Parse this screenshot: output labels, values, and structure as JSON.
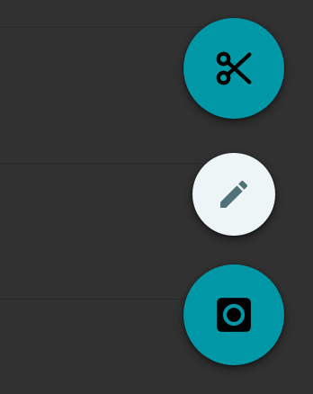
{
  "actions": [
    {
      "name": "cut",
      "icon": "scissors-icon",
      "background": "#0097a7",
      "icon_color": "#000000"
    },
    {
      "name": "edit",
      "icon": "pencil-icon",
      "background": "#eef5f7",
      "icon_color": "#4f7177"
    },
    {
      "name": "camera",
      "icon": "camera-icon",
      "background": "#0097a7",
      "icon_color": "#000000"
    }
  ]
}
